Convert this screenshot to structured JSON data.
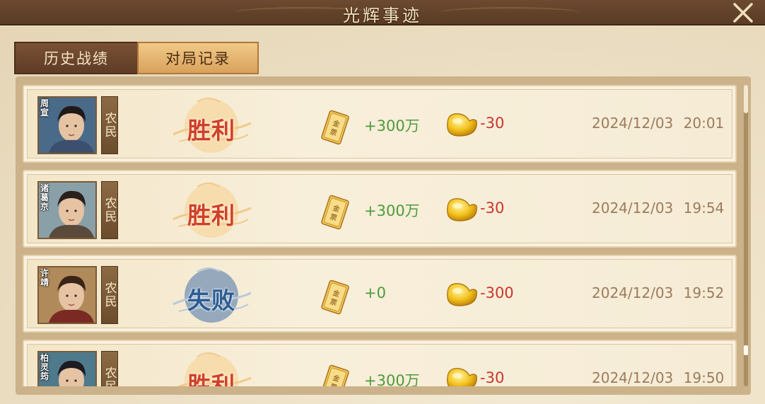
{
  "window": {
    "title": "光辉事迹"
  },
  "tabs": [
    {
      "label": "历史战绩",
      "active": false
    },
    {
      "label": "对局记录",
      "active": true
    }
  ],
  "records": [
    {
      "hero": "周宣",
      "role": "农民",
      "result": "胜利",
      "win": true,
      "coins": "+300万",
      "ingots": "-30",
      "time": "2024/12/03 20:01"
    },
    {
      "hero": "诸葛京",
      "role": "农民",
      "result": "胜利",
      "win": true,
      "coins": "+300万",
      "ingots": "-30",
      "time": "2024/12/03 19:54"
    },
    {
      "hero": "许靖",
      "role": "农民",
      "result": "失败",
      "win": false,
      "coins": "+0",
      "ingots": "-300",
      "time": "2024/12/03 19:52"
    },
    {
      "hero": "柏灵筠",
      "role": "农民",
      "result": "胜利",
      "win": true,
      "coins": "+300万",
      "ingots": "-30",
      "time": "2024/12/03 19:50"
    }
  ],
  "icons": {
    "close": "close-icon",
    "coin_item": "gold-scroll-icon",
    "currency": "gold-ingot-icon"
  },
  "icon_text": {
    "scroll": "金票"
  },
  "colors": {
    "win": "#d0402a",
    "lose": "#2d5c90",
    "coins": "#4e9a3a",
    "ingots": "#c9352b"
  }
}
